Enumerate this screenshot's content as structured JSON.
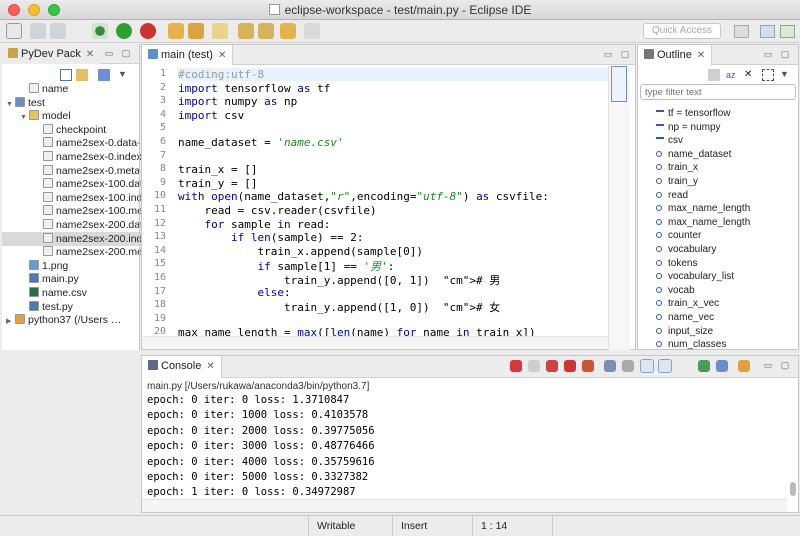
{
  "window": {
    "title": "eclipse-workspace - test/main.py - Eclipse IDE",
    "quick_access": "Quick Access"
  },
  "left_panel": {
    "tab": "PyDev Pack",
    "tree": [
      {
        "label": "name",
        "icon": "file-icon",
        "depth": 1
      },
      {
        "label": "test",
        "icon": "project-icon",
        "depth": 0,
        "expanded": true
      },
      {
        "label": "model",
        "icon": "folder-icon",
        "depth": 1,
        "expanded": true
      },
      {
        "label": "checkpoint",
        "icon": "file-icon",
        "depth": 2
      },
      {
        "label": "name2sex-0.data-",
        "icon": "file-icon",
        "depth": 2
      },
      {
        "label": "name2sex-0.index",
        "icon": "file-icon",
        "depth": 2
      },
      {
        "label": "name2sex-0.meta",
        "icon": "file-icon",
        "depth": 2
      },
      {
        "label": "name2sex-100.dat",
        "icon": "file-icon",
        "depth": 2
      },
      {
        "label": "name2sex-100.ind",
        "icon": "file-icon",
        "depth": 2
      },
      {
        "label": "name2sex-100.me",
        "icon": "file-icon",
        "depth": 2
      },
      {
        "label": "name2sex-200.dat",
        "icon": "file-icon",
        "depth": 2
      },
      {
        "label": "name2sex-200.ind",
        "icon": "file-icon",
        "depth": 2,
        "selected": true
      },
      {
        "label": "name2sex-200.me",
        "icon": "file-icon",
        "depth": 2
      },
      {
        "label": "1.png",
        "icon": "image-icon",
        "depth": 1
      },
      {
        "label": "main.py",
        "icon": "python-file-icon",
        "depth": 1
      },
      {
        "label": "name.csv",
        "icon": "excel-icon",
        "depth": 1
      },
      {
        "label": "test.py",
        "icon": "python-file-icon",
        "depth": 1
      },
      {
        "label": "python37  (/Users … ",
        "icon": "interpreter-icon",
        "depth": 0
      }
    ]
  },
  "editor": {
    "tab": "main (test)",
    "lines": [
      "#coding:utf-8",
      "import tensorflow as tf",
      "import numpy as np",
      "import csv",
      "",
      "name_dataset = 'name.csv'",
      "",
      "train_x = []",
      "train_y = []",
      "with open(name_dataset,\"r\",encoding=\"utf-8\") as csvfile:",
      "    read = csv.reader(csvfile)",
      "    for sample in read:",
      "        if len(sample) == 2:",
      "            train_x.append(sample[0])",
      "            if sample[1] == '男':",
      "                train_y.append([0, 1])  # 男",
      "            else:",
      "                train_y.append([1, 0])  # 女",
      "",
      "max_name_length = max([len(name) for name in train_x])"
    ]
  },
  "outline": {
    "tab": "Outline",
    "filter_placeholder": "type filter text",
    "items": [
      {
        "label": "tf = tensorflow",
        "icon": "import-icon"
      },
      {
        "label": "np = numpy",
        "icon": "import-icon"
      },
      {
        "label": "csv",
        "icon": "import-icon"
      },
      {
        "label": "name_dataset",
        "icon": "variable-icon"
      },
      {
        "label": "train_x",
        "icon": "variable-icon"
      },
      {
        "label": "train_y",
        "icon": "variable-icon"
      },
      {
        "label": "read",
        "icon": "variable-icon"
      },
      {
        "label": "max_name_length",
        "icon": "variable-icon"
      },
      {
        "label": "max_name_length",
        "icon": "variable-icon"
      },
      {
        "label": "counter",
        "icon": "variable-icon"
      },
      {
        "label": "vocabulary",
        "icon": "variable-icon"
      },
      {
        "label": "tokens",
        "icon": "variable-icon"
      },
      {
        "label": "vocabulary_list",
        "icon": "variable-icon"
      },
      {
        "label": "vocab",
        "icon": "variable-icon"
      },
      {
        "label": "train_x_vec",
        "icon": "variable-icon"
      },
      {
        "label": "name_vec",
        "icon": "variable-icon"
      },
      {
        "label": "input_size",
        "icon": "variable-icon"
      },
      {
        "label": "num_classes",
        "icon": "variable-icon"
      }
    ]
  },
  "console": {
    "tab": "Console",
    "process": "main.py [/Users/rukawa/anaconda3/bin/python3.7]",
    "lines": [
      "epoch: 0 iter: 0 loss: 1.3710847",
      "epoch: 0 iter: 1000 loss: 0.4103578",
      "epoch: 0 iter: 2000 loss: 0.39775056",
      "epoch: 0 iter: 3000 loss: 0.48776466",
      "epoch: 0 iter: 4000 loss: 0.35759616",
      "epoch: 0 iter: 5000 loss: 0.3327382",
      "epoch: 1 iter: 0 loss: 0.34972987"
    ]
  },
  "status": {
    "mode": "Writable",
    "insert": "Insert",
    "position": "1 : 14"
  }
}
